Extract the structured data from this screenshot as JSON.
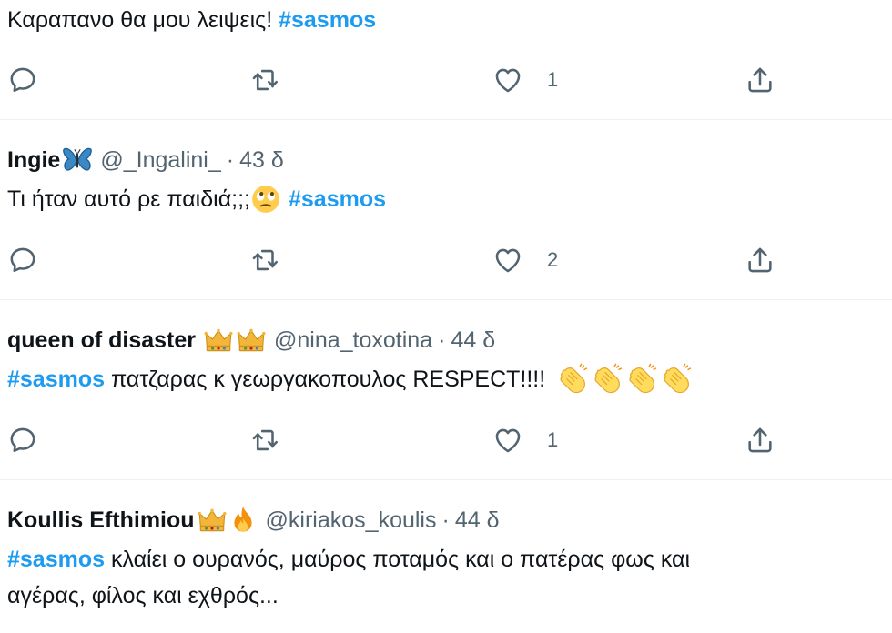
{
  "tweets": [
    {
      "text_before": "Καραπανο θα μου λειψεις! ",
      "hashtag": "#sasmos",
      "like_count": "1"
    },
    {
      "name": "Ingie",
      "name_emoji": "butterfly-emoji",
      "handle": "@_Ingalini_",
      "separator": "·",
      "time": "43 δ",
      "text_before": "Τι ήταν αυτό ρε παιδιά;;;",
      "text_emoji": "face-with-rolling-eyes-emoji",
      "hashtag": "#sasmos",
      "like_count": "2"
    },
    {
      "name": "queen of disaster",
      "name_emoji": "crown-emoji-x2",
      "handle": "@nina_toxotina",
      "separator": "·",
      "time": "44 δ",
      "hashtag": "#sasmos",
      "text_after": " πατζαρας κ γεωργακοπουλος RESPECT!!!! ",
      "text_emoji": "clapping-hands-emoji-x4",
      "like_count": "1"
    },
    {
      "name": "Koullis Efthimiou",
      "name_emoji": "crown-and-fire-emoji",
      "handle": "@kiriakos_koulis",
      "separator": "·",
      "time": "44 δ",
      "hashtag": "#sasmos",
      "text_after": " κλαίει ο ουρανός, μαύρος ποταμός και ο πατέρας φως και",
      "text_line2": "αγέρας, φίλος και εχθρός..."
    }
  ],
  "icons": {
    "reply": "reply-icon",
    "retweet": "retweet-icon",
    "like": "like-icon",
    "share": "share-icon"
  },
  "colors": {
    "hashtag": "#1d9bf0",
    "secondary_text": "#536471",
    "divider": "#eff3f4"
  }
}
